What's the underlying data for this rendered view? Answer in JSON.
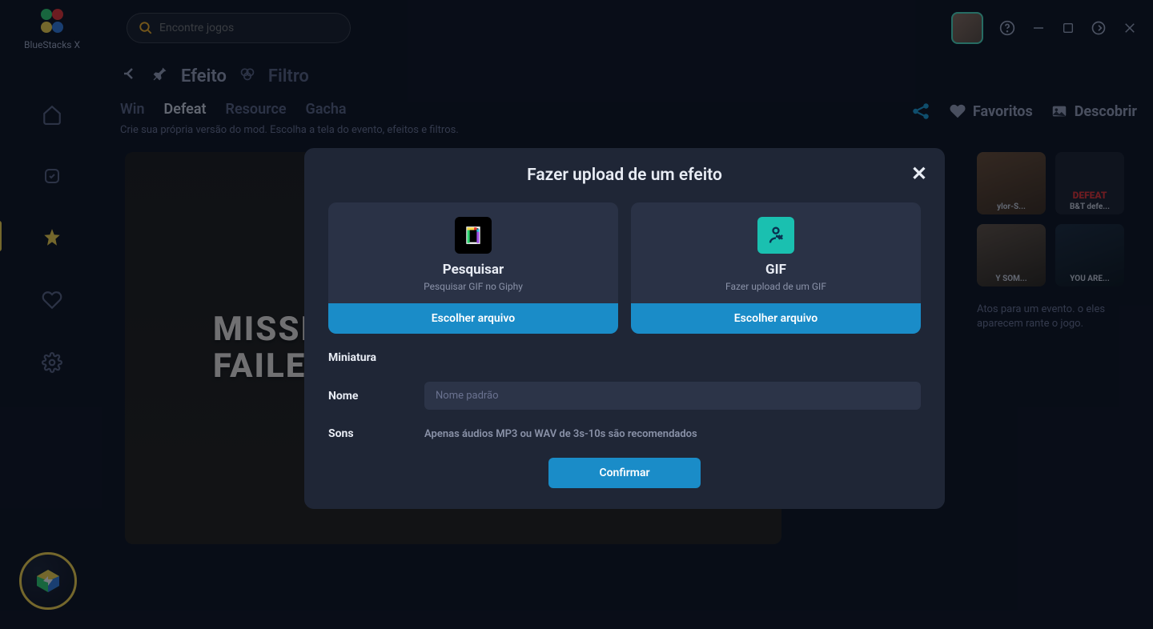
{
  "brand": "BlueStacks X",
  "search": {
    "placeholder": "Encontre jogos"
  },
  "breadcrumb": {
    "effect": "Efeito",
    "filter": "Filtro"
  },
  "tabs": {
    "win": "Win",
    "defeat": "Defeat",
    "resource": "Resource",
    "gacha": "Gacha"
  },
  "subcaption": "Crie sua própria versão do mod. Escolha a tela do evento, efeitos e filtros.",
  "actions": {
    "favoritos": "Favoritos",
    "descobrir": "Descobrir"
  },
  "preview": {
    "line1": "MISSI",
    "line2": "FAILE"
  },
  "thumbs": {
    "a": "ylor-S...",
    "b_label": "DEFEAT",
    "b": "B&T defe...",
    "c": "Y SOM...",
    "d": "YOU ARE..."
  },
  "hint": "Atos para um evento. o eles aparecem rante o jogo.",
  "modal": {
    "title": "Fazer upload de um efeito",
    "search_card": {
      "title": "Pesquisar",
      "sub": "Pesquisar GIF no Giphy",
      "button": "Escolher arquivo"
    },
    "gif_card": {
      "title": "GIF",
      "sub": "Fazer upload de um GIF",
      "button": "Escolher arquivo"
    },
    "thumbnail_label": "Miniatura",
    "name_label": "Nome",
    "name_placeholder": "Nome padrão",
    "sounds_label": "Sons",
    "sounds_hint": "Apenas áudios MP3 ou WAV de 3s-10s são recomendados",
    "confirm": "Confirmar"
  }
}
